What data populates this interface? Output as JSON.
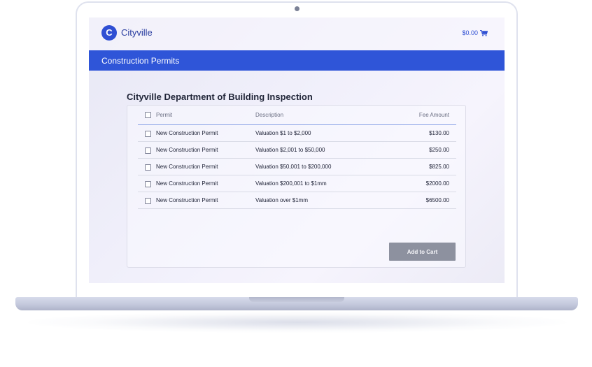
{
  "header": {
    "logo_letter": "C",
    "brand": "Cityville",
    "cart_total": "$0.00"
  },
  "banner": {
    "title": "Construction Permits"
  },
  "main": {
    "title": "Cityville Department of Building Inspection",
    "columns": {
      "permit": "Permit",
      "description": "Description",
      "fee": "Fee Amount"
    },
    "rows": [
      {
        "permit": "New Construction Permit",
        "description": "Valuation $1 to $2,000",
        "fee": "$130.00"
      },
      {
        "permit": "New Construction Permit",
        "description": "Valuation $2,001 to $50,000",
        "fee": "$250.00"
      },
      {
        "permit": "New Construction Permit",
        "description": "Valuation $50,001 to $200,000",
        "fee": "$825.00"
      },
      {
        "permit": "New Construction Permit",
        "description": "Valuation $200,001 to $1mm",
        "fee": "$2000.00"
      },
      {
        "permit": "New Construction Permit",
        "description": "Valuation over $1mm",
        "fee": "$6500.00"
      }
    ],
    "add_to_cart_label": "Add to Cart"
  },
  "colors": {
    "accent": "#2f55d8",
    "button_disabled": "#8d919f"
  },
  "icons": {
    "cart": "shopping-cart-icon"
  }
}
